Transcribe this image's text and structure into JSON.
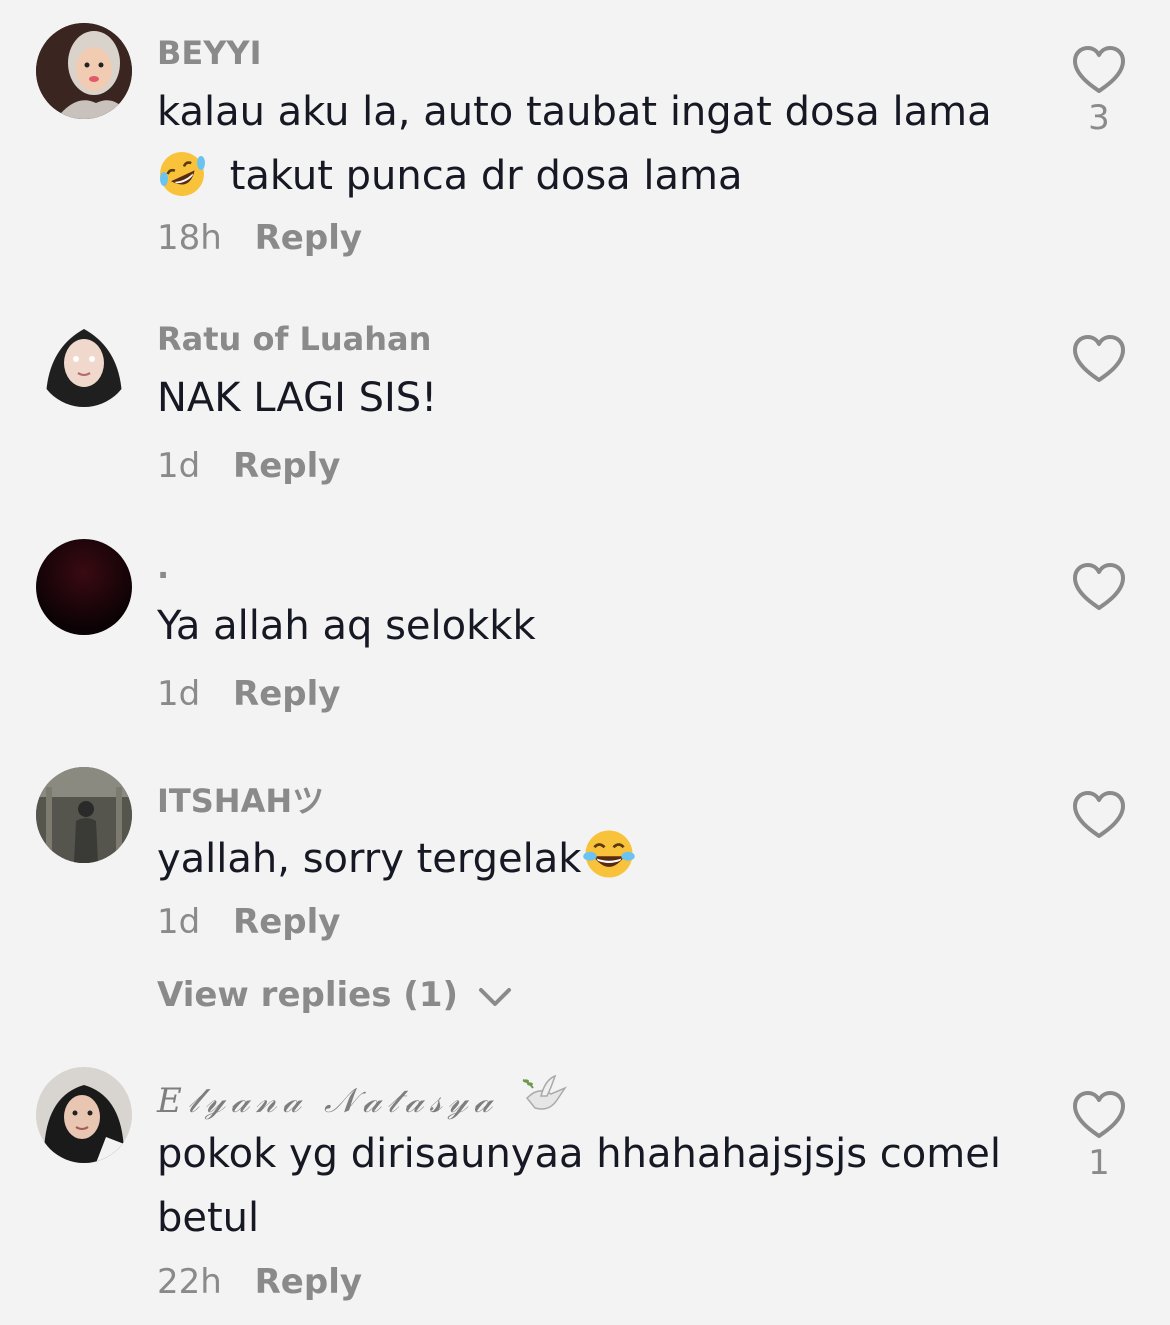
{
  "comments": [
    {
      "username": "BEYYI",
      "text_line1": "kalau aku la, auto taubat ingat dosa lama",
      "text_line2": "takut punca dr dosa lama",
      "emoji": "rofl-emoji",
      "time": "18h",
      "reply": "Reply",
      "likes": "3"
    },
    {
      "username": "Ratu of Luahan",
      "text": "NAK LAGI SIS!",
      "time": "1d",
      "reply": "Reply",
      "likes": ""
    },
    {
      "username": ".",
      "text": "Ya allah aq selokkk",
      "time": "1d",
      "reply": "Reply",
      "likes": ""
    },
    {
      "username": "ITSHAHツ",
      "text": "yallah, sorry tergelak",
      "emoji": "tears-of-joy-emoji",
      "time": "1d",
      "reply": "Reply",
      "likes": "",
      "view_replies": "View replies (1)"
    },
    {
      "username": "𝐸𝓁𝓎𝒶𝓃𝒶 𝒩𝒶𝓉𝒶𝓈𝓎𝒶",
      "username_emoji": "dove-emoji",
      "text_line1": "pokok yg dirisaunyaa hhahahajsjsjs comel",
      "text_line2": "betul",
      "time": "22h",
      "reply": "Reply",
      "likes": "1"
    }
  ],
  "colors": {
    "background": "#f4f3f3",
    "primary_text": "#161823",
    "secondary_text": "#8a8a8a"
  }
}
